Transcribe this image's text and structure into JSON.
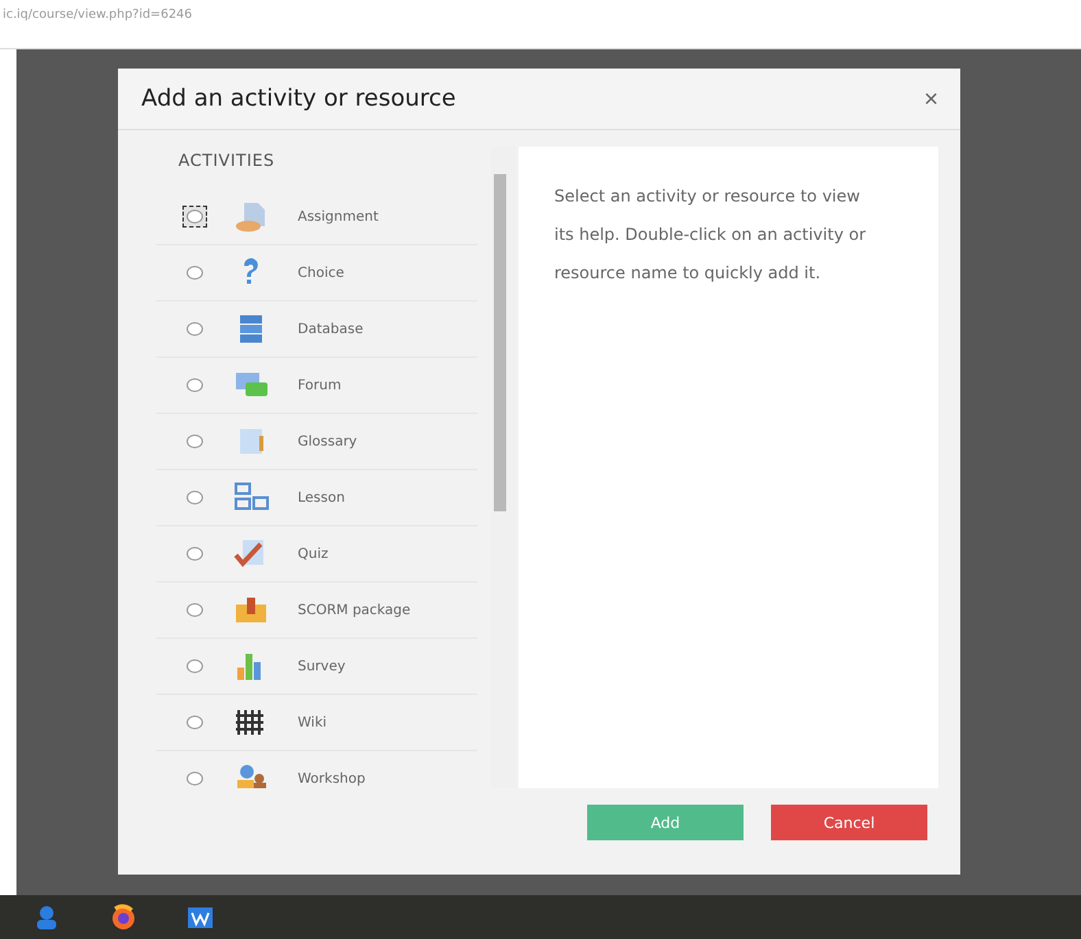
{
  "address_bar": {
    "url": "ic.iq/course/view.php?id=6246"
  },
  "dialog": {
    "title": "Add an activity or resource",
    "close": "×",
    "section": "ACTIVITIES",
    "items": [
      {
        "label": "Assignment",
        "selected": false,
        "focused": true
      },
      {
        "label": "Choice",
        "selected": false,
        "focused": false
      },
      {
        "label": "Database",
        "selected": false,
        "focused": false
      },
      {
        "label": "Forum",
        "selected": false,
        "focused": false
      },
      {
        "label": "Glossary",
        "selected": false,
        "focused": false
      },
      {
        "label": "Lesson",
        "selected": false,
        "focused": false
      },
      {
        "label": "Quiz",
        "selected": false,
        "focused": false
      },
      {
        "label": "SCORM package",
        "selected": false,
        "focused": false
      },
      {
        "label": "Survey",
        "selected": false,
        "focused": false
      },
      {
        "label": "Wiki",
        "selected": false,
        "focused": false
      },
      {
        "label": "Workshop",
        "selected": false,
        "focused": false
      }
    ],
    "help": "Select an activity or resource to view its help. Double-click on an activity or resource name to quickly add it.",
    "buttons": [
      {
        "label": "Add",
        "kind": "primary"
      },
      {
        "label": "Cancel",
        "kind": "danger"
      }
    ]
  }
}
